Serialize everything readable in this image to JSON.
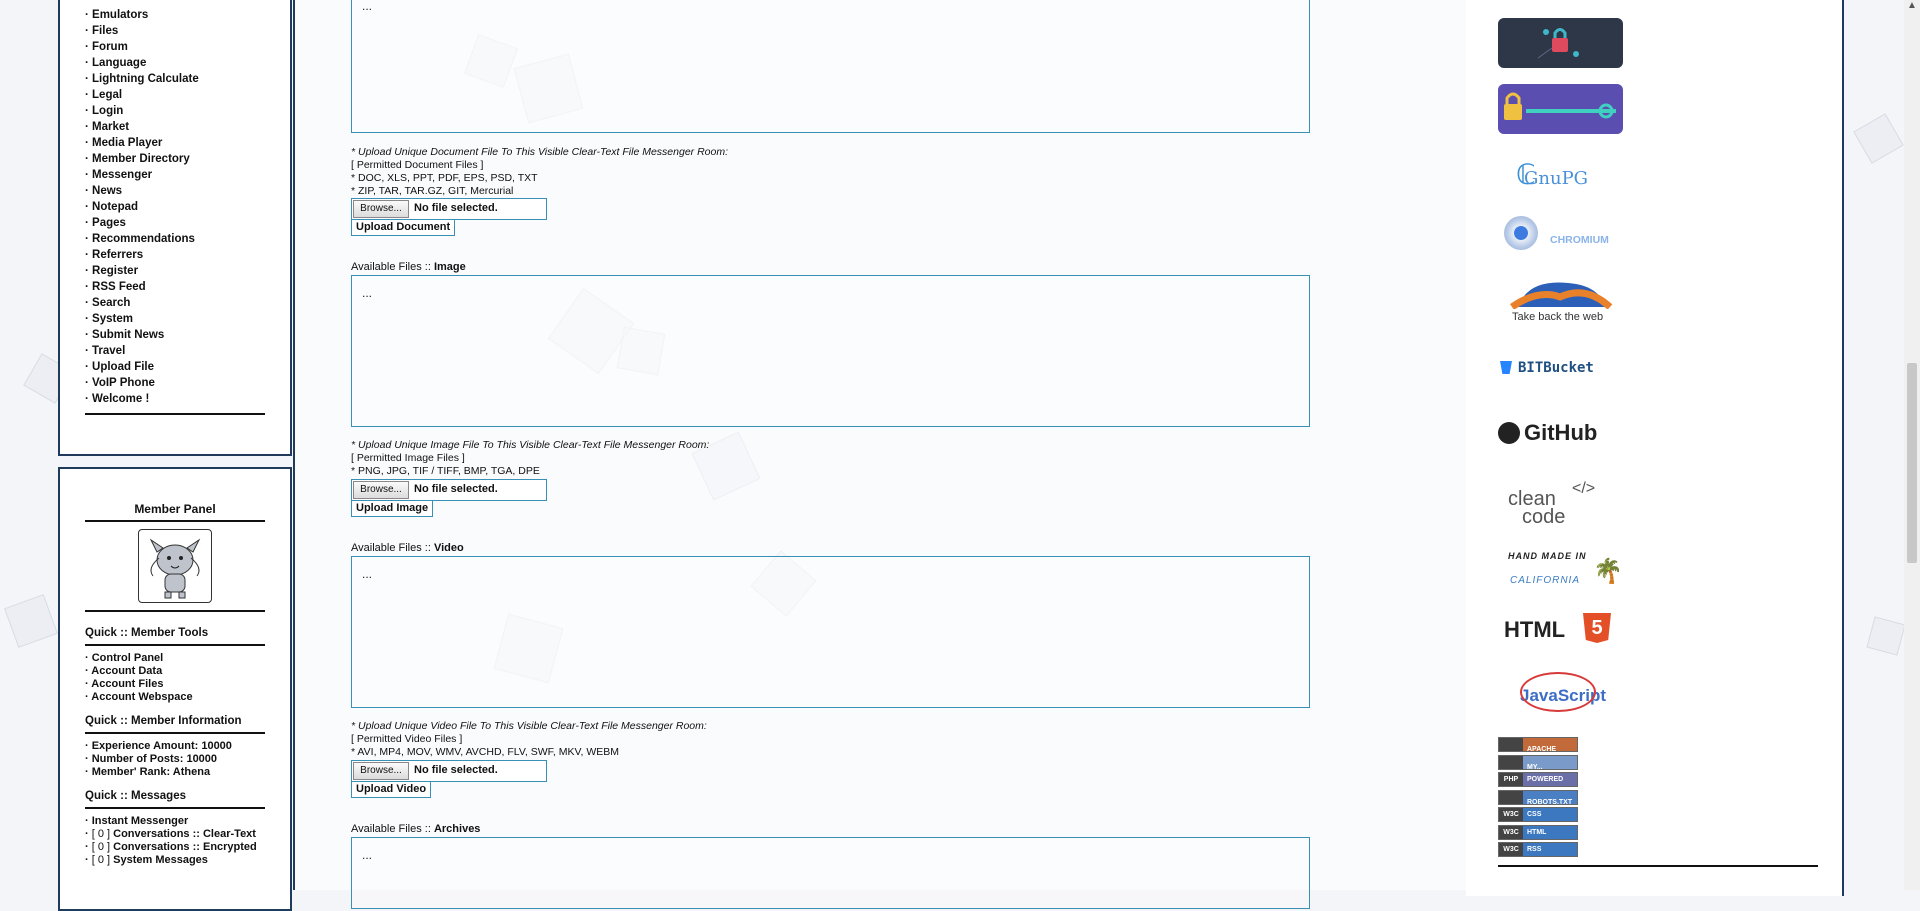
{
  "nav_items": [
    "· Emulators",
    "· Files",
    "· Forum",
    "· Language",
    "· Lightning Calculate",
    "· Legal",
    "· Login",
    "· Market",
    "· Media Player",
    "· Member Directory",
    "· Messenger",
    "· News",
    "· Notepad",
    "· Pages",
    "· Recommendations",
    "· Referrers",
    "· Register",
    "· RSS Feed",
    "· Search",
    "· System",
    "· Submit News",
    "· Travel",
    "· Upload File",
    "· VoIP Phone",
    "· Welcome !"
  ],
  "member_panel": {
    "title": "Member Panel",
    "tools_title": "Quick :: Member Tools",
    "tools": [
      "· Control Panel",
      "· Account Data",
      "· Account Files",
      "· Account Webspace"
    ],
    "info_title": "Quick :: Member Information",
    "info": [
      "· Experience Amount: 10000",
      "· Number of Posts: 10000",
      "· Member' Rank: Athena"
    ],
    "messages_title": "Quick :: Messages",
    "messages": [
      {
        "label": "· Instant Messenger",
        "prefix": "",
        "suffix": ""
      },
      {
        "label": "· ",
        "prefix": "[ 0 ]",
        "suffix": " Conversations :: Clear-Text"
      },
      {
        "label": "· ",
        "prefix": "[ 0 ]",
        "suffix": " Conversations :: Encrypted"
      },
      {
        "label": "· ",
        "prefix": "[ 0 ]",
        "suffix": " System Messages"
      }
    ]
  },
  "main": {
    "dots": "...",
    "document": {
      "heading": "* Upload Unique Document File To This Visible Clear-Text File Messenger Room:",
      "permitted": "[ Permitted Document Files ]",
      "types1": "* DOC, XLS, PPT, PDF, EPS, PSD, TXT",
      "types2": "* ZIP, TAR, TAR.GZ, GIT, Mercurial",
      "browse": "Browse...",
      "nofile": "No file selected.",
      "button": "Upload Document"
    },
    "image": {
      "avail_prefix": "Available Files :: ",
      "avail_type": "Image",
      "heading": "* Upload Unique Image File To This Visible Clear-Text File Messenger Room:",
      "permitted": "[ Permitted Image Files ]",
      "types1": "* PNG, JPG, TIF / TIFF, BMP, TGA, DPE",
      "browse": "Browse...",
      "nofile": "No file selected.",
      "button": "Upload Image"
    },
    "video": {
      "avail_prefix": "Available Files :: ",
      "avail_type": "Video",
      "heading": "* Upload Unique Video File To This Visible Clear-Text File Messenger Room:",
      "permitted": "[ Permitted Video Files ]",
      "types1": "* AVI, MP4, MOV, WMV, AVCHD, FLV, SWF, MKV, WEBM",
      "browse": "Browse...",
      "nofile": "No file selected.",
      "button": "Upload Video"
    },
    "archives": {
      "avail_prefix": "Available Files :: ",
      "avail_type": "Archives"
    }
  },
  "right_badges": {
    "gnupg": "GnuPG",
    "chromium": "CHROMIUM",
    "firefox": "Take back the web",
    "bitbucket": "BITBucket",
    "github": "GitHub",
    "cleancode_top": "clean",
    "cleancode_bottom": "code",
    "cleancode_tag": "</>",
    "handmade_top": "HAND MADE IN",
    "handmade_bottom": "CALIFORNIA",
    "html": "HTML",
    "html_num": "5",
    "javascript": "JavaScript",
    "small": [
      {
        "l": "",
        "r": "APACHE"
      },
      {
        "l": "",
        "r": "MY..."
      },
      {
        "l": "PHP",
        "r": "POWERED"
      },
      {
        "l": "",
        "r": "ROBOTS.TXT"
      },
      {
        "l": "W3C",
        "r": "CSS"
      },
      {
        "l": "W3C",
        "r": "HTML"
      },
      {
        "l": "W3C",
        "r": "RSS"
      }
    ]
  },
  "colors": {
    "frame": "#1f3a5a",
    "field_border": "#3a8fb7"
  }
}
